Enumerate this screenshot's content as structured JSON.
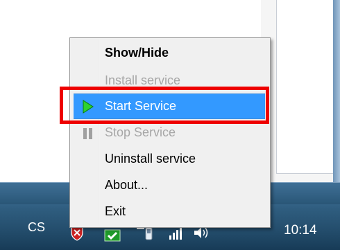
{
  "context_menu": {
    "items": [
      {
        "label": "Show/Hide",
        "bold": true,
        "enabled": true
      },
      {
        "label": "Install service",
        "enabled": false
      },
      {
        "label": "Start Service",
        "enabled": true,
        "selected": true,
        "icon": "play-icon"
      },
      {
        "label": "Stop Service",
        "enabled": false,
        "icon": "pause-icon"
      },
      {
        "label": "Uninstall service",
        "enabled": true
      },
      {
        "label": "About...",
        "enabled": true
      },
      {
        "label": "Exit",
        "enabled": true
      }
    ],
    "highlight_color": "#3399ff",
    "annotation_color": "#ee0000"
  },
  "taskbar": {
    "language": "CS",
    "clock": "10:14",
    "tray_icons": [
      "shield-alert-icon",
      "check-icon",
      "device-icon",
      "signal-icon",
      "volume-icon"
    ]
  }
}
